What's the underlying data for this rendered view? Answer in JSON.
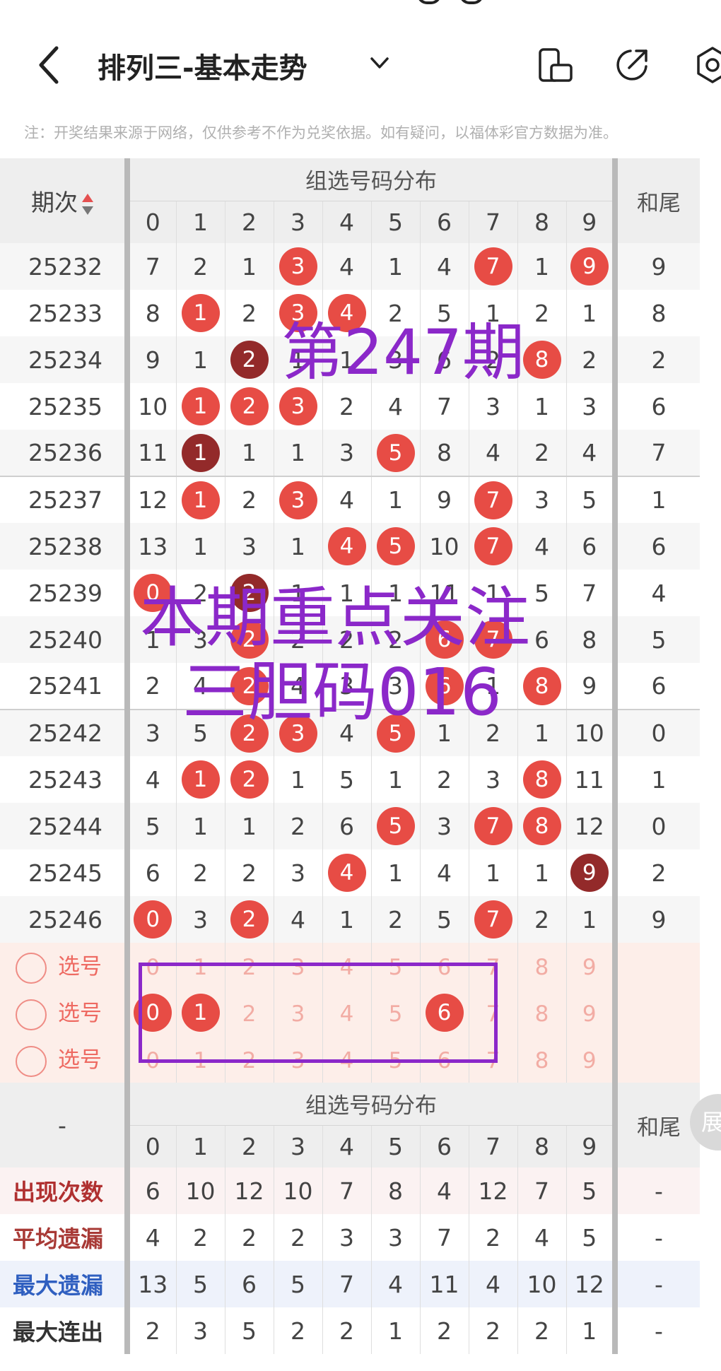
{
  "topbar": {
    "title": "排列三-基本走势"
  },
  "note": "注：开奖结果来源于网络，仅供参考不作为兑奖依据。如有疑问，以福体彩官方数据为准。",
  "table_header": {
    "period_label": "期次",
    "group_title": "组选号码分布",
    "tail_label": "和尾",
    "digits": [
      "0",
      "1",
      "2",
      "3",
      "4",
      "5",
      "6",
      "7",
      "8",
      "9"
    ]
  },
  "rows": [
    {
      "period": "25232",
      "cells": [
        "7",
        "2",
        "1",
        "3",
        "4",
        "1",
        "4",
        "7",
        "1",
        "9"
      ],
      "style": [
        "",
        "",
        "",
        "r",
        "",
        "",
        "",
        "r",
        "",
        "r"
      ],
      "tail": "9"
    },
    {
      "period": "25233",
      "cells": [
        "8",
        "1",
        "2",
        "3",
        "4",
        "2",
        "5",
        "1",
        "2",
        "1"
      ],
      "style": [
        "",
        "r",
        "",
        "r",
        "r",
        "",
        "",
        "",
        "",
        ""
      ],
      "tail": "8"
    },
    {
      "period": "25234",
      "cells": [
        "9",
        "1",
        "2",
        "1",
        "1",
        "3",
        "6",
        "2",
        "8",
        "2"
      ],
      "style": [
        "",
        "",
        "d",
        "",
        "",
        "",
        "",
        "",
        "r",
        ""
      ],
      "tail": "2"
    },
    {
      "period": "25235",
      "cells": [
        "10",
        "1",
        "2",
        "3",
        "2",
        "4",
        "7",
        "3",
        "1",
        "3"
      ],
      "style": [
        "",
        "r",
        "r",
        "r",
        "",
        "",
        "",
        "",
        "",
        ""
      ],
      "tail": "6"
    },
    {
      "period": "25236",
      "cells": [
        "11",
        "1",
        "1",
        "1",
        "3",
        "5",
        "8",
        "4",
        "2",
        "4"
      ],
      "style": [
        "",
        "d",
        "",
        "",
        "",
        "r",
        "",
        "",
        "",
        ""
      ],
      "tail": "7"
    },
    {
      "period": "25237",
      "cells": [
        "12",
        "1",
        "2",
        "3",
        "4",
        "1",
        "9",
        "7",
        "3",
        "5"
      ],
      "style": [
        "",
        "r",
        "",
        "r",
        "",
        "",
        "",
        "r",
        "",
        ""
      ],
      "tail": "1"
    },
    {
      "period": "25238",
      "cells": [
        "13",
        "1",
        "3",
        "1",
        "4",
        "5",
        "10",
        "7",
        "4",
        "6"
      ],
      "style": [
        "",
        "",
        "",
        "",
        "r",
        "r",
        "",
        "r",
        "",
        ""
      ],
      "tail": "6"
    },
    {
      "period": "25239",
      "cells": [
        "0",
        "2",
        "2",
        "1",
        "1",
        "1",
        "11",
        "1",
        "5",
        "7"
      ],
      "style": [
        "r",
        "",
        "d",
        "",
        "",
        "",
        "",
        "",
        "",
        ""
      ],
      "tail": "4"
    },
    {
      "period": "25240",
      "cells": [
        "1",
        "3",
        "2",
        "2",
        "2",
        "2",
        "6",
        "7",
        "6",
        "8"
      ],
      "style": [
        "",
        "",
        "r",
        "",
        "",
        "",
        "r",
        "r",
        "",
        ""
      ],
      "tail": "5"
    },
    {
      "period": "25241",
      "cells": [
        "2",
        "4",
        "2",
        "4",
        "3",
        "3",
        "6",
        "1",
        "8",
        "9"
      ],
      "style": [
        "",
        "",
        "r",
        "",
        "",
        "",
        "r",
        "",
        "r",
        ""
      ],
      "tail": "6"
    },
    {
      "period": "25242",
      "cells": [
        "3",
        "5",
        "2",
        "3",
        "4",
        "5",
        "1",
        "2",
        "1",
        "10"
      ],
      "style": [
        "",
        "",
        "r",
        "r",
        "",
        "r",
        "",
        "",
        "",
        ""
      ],
      "tail": "0"
    },
    {
      "period": "25243",
      "cells": [
        "4",
        "1",
        "2",
        "1",
        "5",
        "1",
        "2",
        "3",
        "8",
        "11"
      ],
      "style": [
        "",
        "r",
        "r",
        "",
        "",
        "",
        "",
        "",
        "r",
        ""
      ],
      "tail": "1"
    },
    {
      "period": "25244",
      "cells": [
        "5",
        "1",
        "1",
        "2",
        "6",
        "5",
        "3",
        "7",
        "8",
        "12"
      ],
      "style": [
        "",
        "",
        "",
        "",
        "",
        "r",
        "",
        "r",
        "r",
        ""
      ],
      "tail": "0"
    },
    {
      "period": "25245",
      "cells": [
        "6",
        "2",
        "2",
        "3",
        "4",
        "1",
        "4",
        "1",
        "1",
        "9"
      ],
      "style": [
        "",
        "",
        "",
        "",
        "r",
        "",
        "",
        "",
        "",
        "d"
      ],
      "tail": "2"
    },
    {
      "period": "25246",
      "cells": [
        "0",
        "3",
        "2",
        "4",
        "1",
        "2",
        "5",
        "7",
        "2",
        "1"
      ],
      "style": [
        "r",
        "",
        "r",
        "",
        "",
        "",
        "",
        "r",
        "",
        ""
      ],
      "tail": "9"
    }
  ],
  "selection": {
    "option_label": "选号",
    "rows": [
      {
        "cells": [
          "0",
          "1",
          "2",
          "3",
          "4",
          "5",
          "6",
          "7",
          "8",
          "9"
        ],
        "selected": []
      },
      {
        "cells": [
          "0",
          "1",
          "2",
          "3",
          "4",
          "5",
          "6",
          "7",
          "8",
          "9"
        ],
        "selected": [
          0,
          1,
          6
        ]
      },
      {
        "cells": [
          "0",
          "1",
          "2",
          "3",
          "4",
          "5",
          "6",
          "7",
          "8",
          "9"
        ],
        "selected": []
      }
    ]
  },
  "stats_header": {
    "period_label": "-",
    "group_title": "组选号码分布",
    "tail_label": "和尾",
    "expand_label": "展"
  },
  "stats": [
    {
      "key": "appear",
      "label": "出现次数",
      "values": [
        "6",
        "10",
        "12",
        "10",
        "7",
        "8",
        "4",
        "12",
        "7",
        "5"
      ],
      "tail": "-"
    },
    {
      "key": "avg",
      "label": "平均遗漏",
      "values": [
        "4",
        "2",
        "2",
        "2",
        "3",
        "3",
        "7",
        "2",
        "4",
        "5"
      ],
      "tail": "-"
    },
    {
      "key": "max",
      "label": "最大遗漏",
      "values": [
        "13",
        "5",
        "6",
        "5",
        "7",
        "4",
        "11",
        "4",
        "10",
        "12"
      ],
      "tail": "-"
    },
    {
      "key": "run",
      "label": "最大连出",
      "values": [
        "2",
        "3",
        "5",
        "2",
        "2",
        "1",
        "2",
        "2",
        "2",
        "1"
      ],
      "tail": "-"
    }
  ],
  "overlays": {
    "issue": "第247期",
    "focus_line1": "本期重点关注",
    "focus_line2": "三胆码016"
  },
  "colors": {
    "ball_red": "#e74c45",
    "ball_dark": "#932a2a",
    "overlay_purple": "#8b28c9"
  }
}
